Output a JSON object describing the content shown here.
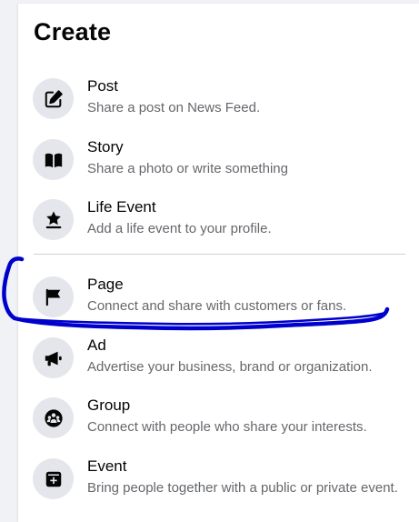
{
  "title": "Create",
  "items": [
    {
      "label": "Post",
      "desc": "Share a post on News Feed."
    },
    {
      "label": "Story",
      "desc": "Share a photo or write something"
    },
    {
      "label": "Life Event",
      "desc": "Add a life event to your profile."
    },
    {
      "label": "Page",
      "desc": "Connect and share with customers or fans."
    },
    {
      "label": "Ad",
      "desc": "Advertise your business, brand or organization."
    },
    {
      "label": "Group",
      "desc": "Connect with people who share your interests."
    },
    {
      "label": "Event",
      "desc": "Bring people together with a public or private event."
    }
  ],
  "icons": [
    "edit-icon",
    "book-icon",
    "star-icon",
    "flag-icon",
    "megaphone-icon",
    "group-icon",
    "calendar-plus-icon"
  ],
  "colors": {
    "background": "#f0f2f5",
    "panel": "#ffffff",
    "icon_circle": "#e4e6eb",
    "icon": "#050505",
    "label": "#050505",
    "description": "#65676b",
    "annotation": "#0000cc"
  }
}
